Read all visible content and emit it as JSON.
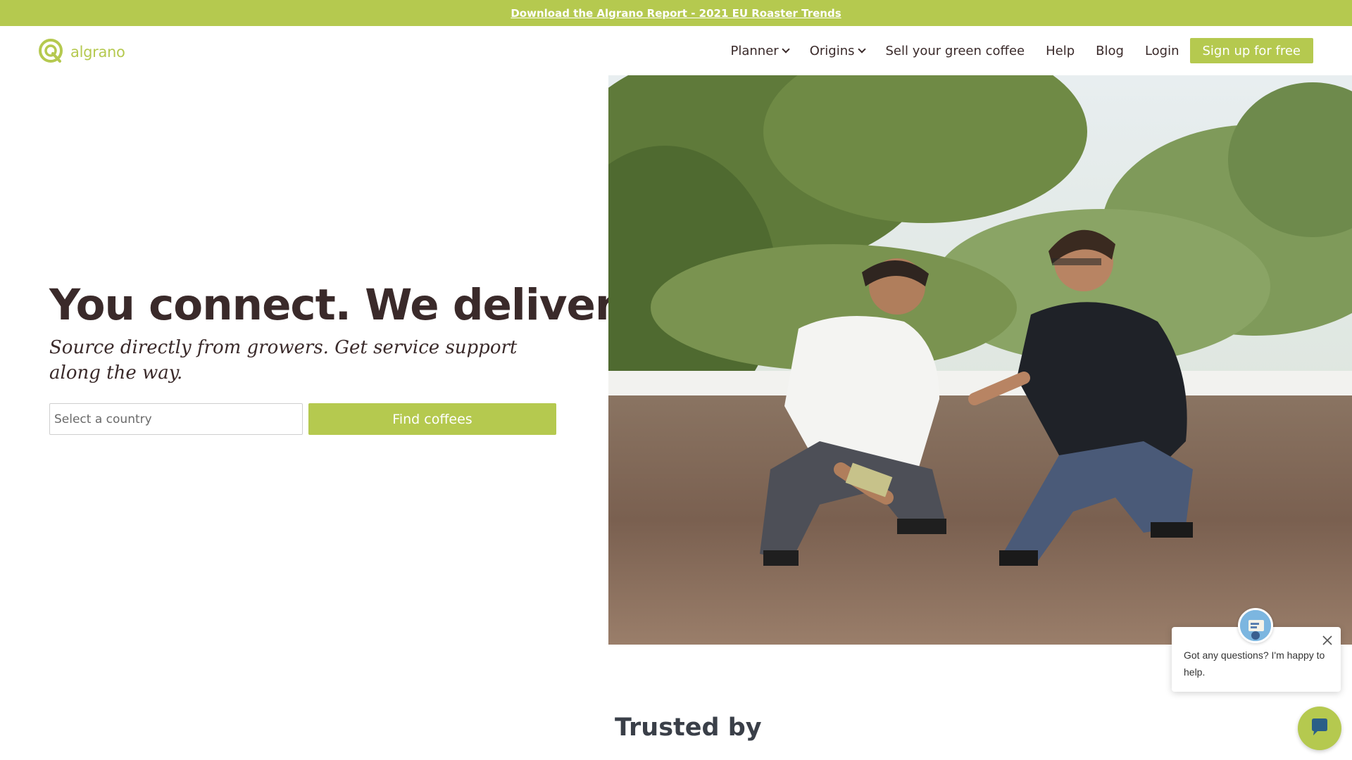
{
  "banner": {
    "link_text": "Download the Algrano Report - 2021 EU Roaster Trends"
  },
  "header": {
    "logo_text": "algrano",
    "nav": [
      {
        "label": "Planner",
        "has_dropdown": true
      },
      {
        "label": "Origins",
        "has_dropdown": true
      },
      {
        "label": "Sell your green coffee",
        "has_dropdown": false
      },
      {
        "label": "Help",
        "has_dropdown": false
      },
      {
        "label": "Blog",
        "has_dropdown": false
      },
      {
        "label": "Login",
        "has_dropdown": false
      }
    ],
    "signup_label": "Sign up for free"
  },
  "hero": {
    "title": "You connect. We deliver.",
    "subtitle": "Source directly from growers. Get service support along the way.",
    "country_placeholder": "Select a country",
    "find_button": "Find coffees"
  },
  "trusted": {
    "heading": "Trusted by"
  },
  "chat": {
    "message": "Got any questions? I'm happy to help."
  },
  "colors": {
    "brand_green": "#b5c94f",
    "text_dark": "#3a2a2a"
  },
  "icons": {
    "logo": "algrano-q-logo-icon",
    "dropdown": "chevron-down-icon",
    "close": "close-icon",
    "chat": "chat-bubble-icon"
  }
}
